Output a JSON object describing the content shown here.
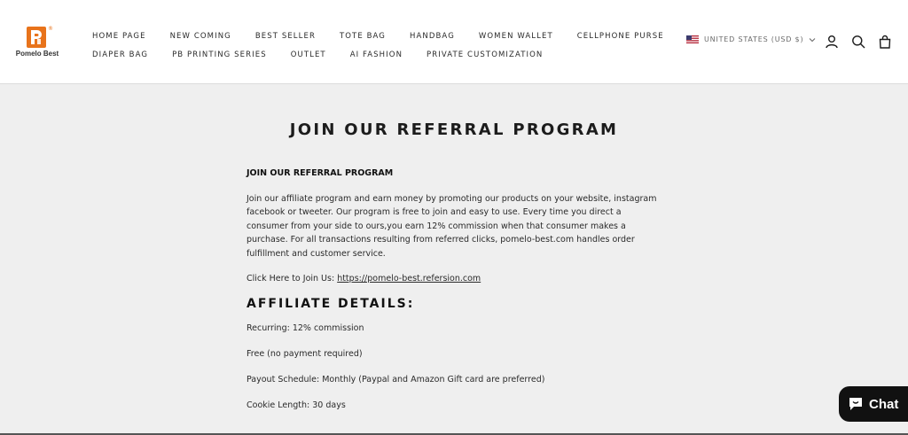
{
  "header": {
    "logo_text": "Pomelo Best",
    "logo_reg": "®",
    "brand_color": "#e8731b",
    "nav_row1": [
      "HOME PAGE",
      "NEW COMING",
      "BEST SELLER",
      "TOTE BAG",
      "HANDBAG",
      "WOMEN WALLET",
      "CELLPHONE PURSE"
    ],
    "nav_row2": [
      "DIAPER BAG",
      "PB PRINTING SERIES",
      "OUTLET",
      "AI FASHION",
      "PRIVATE CUSTOMIZATION"
    ],
    "locale": "UNITED STATES (USD $)",
    "icons": [
      "us-flag-icon",
      "account-icon",
      "search-icon",
      "cart-bag-icon"
    ]
  },
  "main": {
    "page_title": "JOIN OUR REFERRAL PROGRAM",
    "content_heading": "JOIN OUR REFERRAL PROGRAM",
    "intro": "Join our affiliate program and earn money by promoting our products on your website, instagram facebook or tweeter. Our program is free to join and easy to use. Every time you direct a consumer from your side to ours,you earn 12% commission when that consumer makes a purchase. For all transactions resulting from referred clicks, pomelo-best.com handles order fulfillment and customer service.",
    "join_prefix": "Click Here to Join Us: ",
    "join_link": "https://pomelo-best.refersion.com",
    "details_heading": "AFFILIATE DETAILS:",
    "details": [
      "Recurring: 12% commission",
      "Free (no payment required)",
      "Payout Schedule: Monthly (Paypal and Amazon Gift card are preferred)",
      "Cookie Length: 30 days"
    ]
  },
  "chat": {
    "label": "Chat"
  }
}
